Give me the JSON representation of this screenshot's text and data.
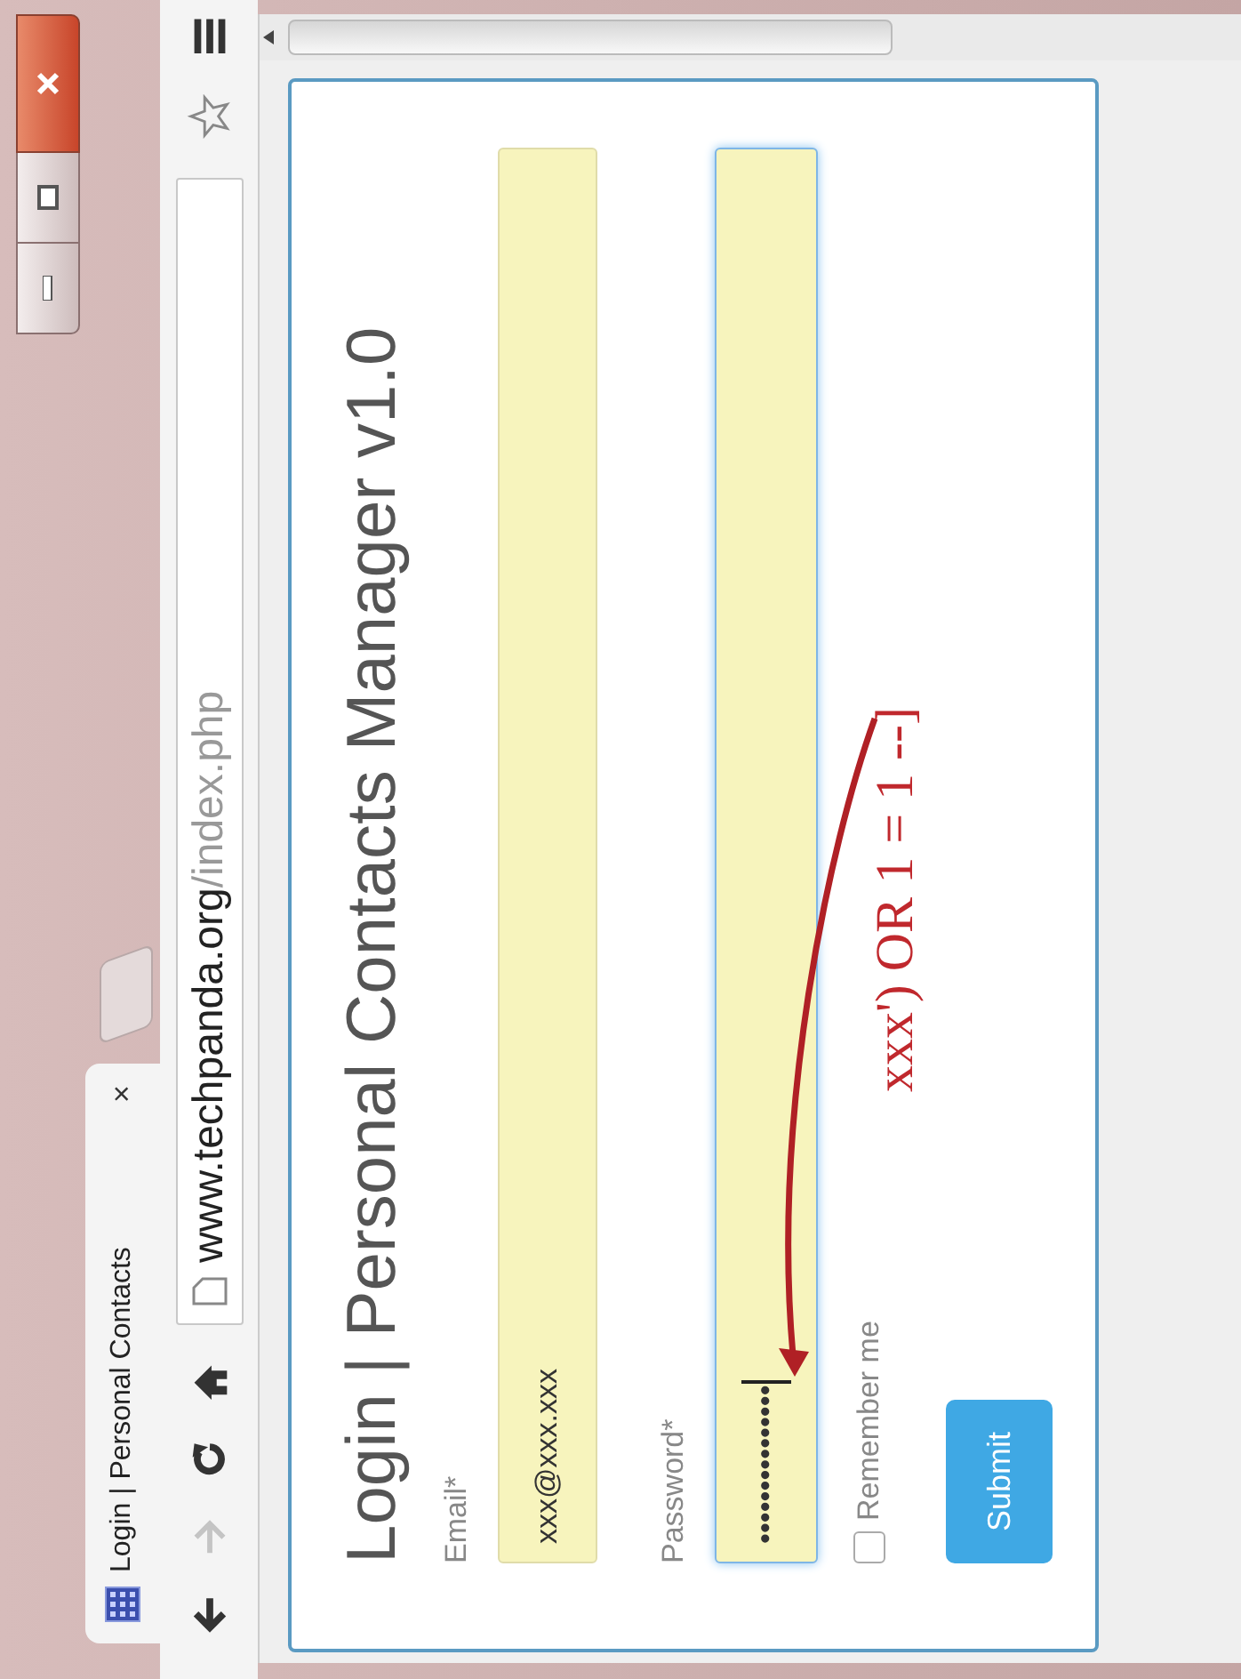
{
  "tab": {
    "title": "Login | Personal Contacts",
    "close": "×"
  },
  "toolbar": {
    "forward_disabled": true,
    "url": {
      "host": "www.techpanda.org",
      "path": "/index.php"
    }
  },
  "form": {
    "heading": "Login | Personal Contacts Manager v1.0",
    "fields": [
      {
        "label": "Email*",
        "value": "xxx@xxx.xxx",
        "focused": false
      },
      {
        "label": "Password*",
        "value": "•••••••••••••••",
        "focused": true
      }
    ],
    "remember": {
      "label": "Remember me",
      "checked": false
    },
    "submit": "Submit"
  },
  "annotation": {
    "text": "xxx') OR 1 = 1 --]"
  }
}
